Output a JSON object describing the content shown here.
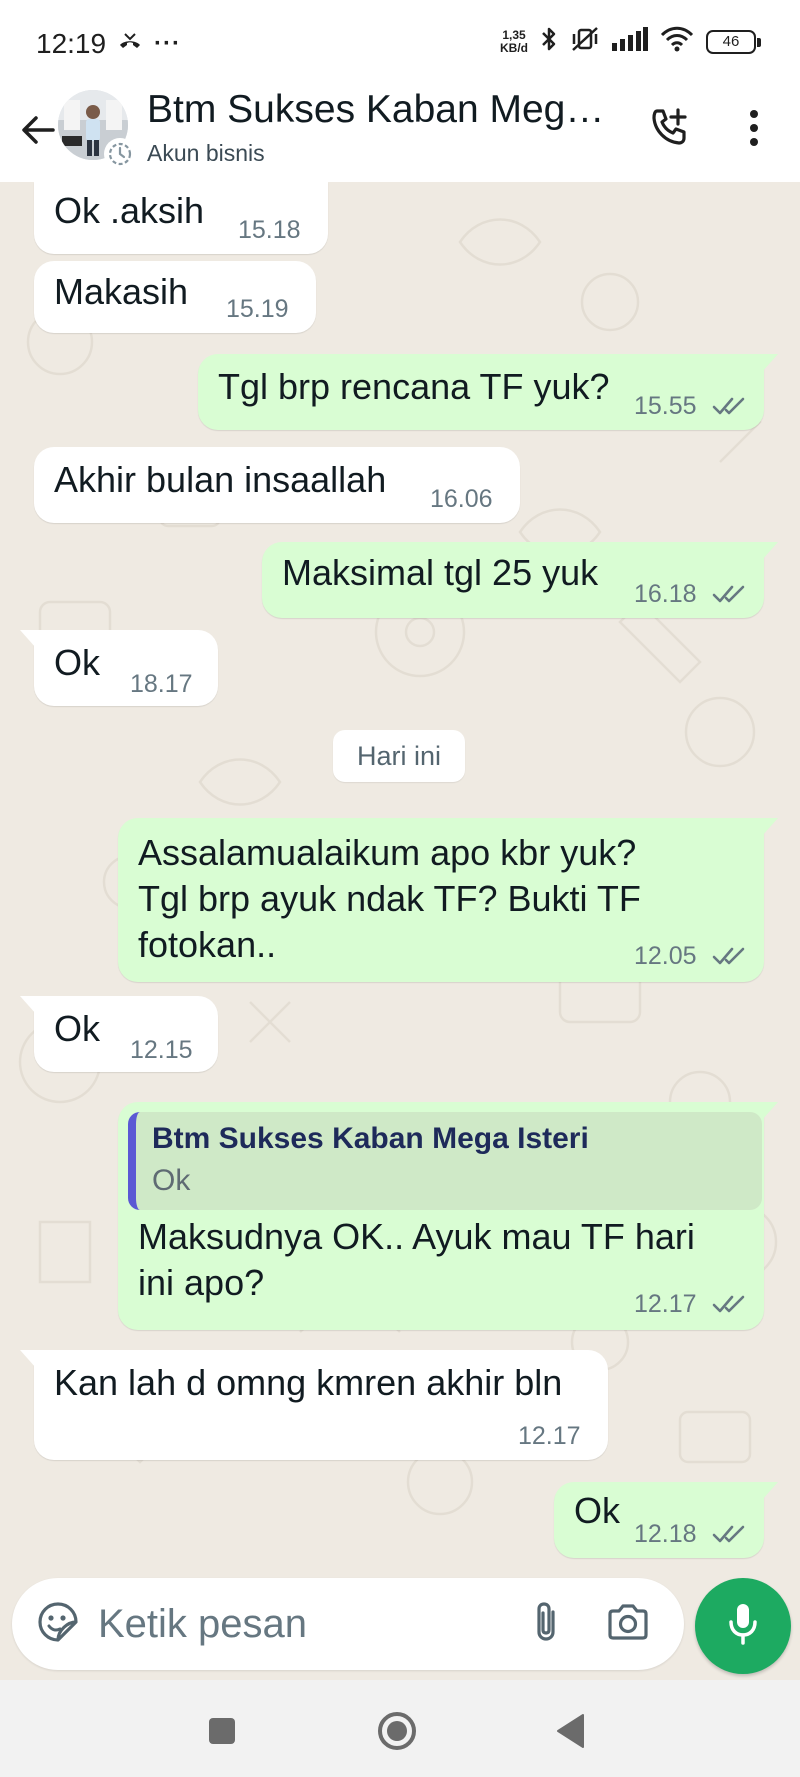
{
  "status_bar": {
    "time": "12:19",
    "more_dots": "···",
    "net_speed_value": "1,35",
    "net_speed_unit": "KB/d",
    "battery": "46"
  },
  "header": {
    "contact_name": "Btm Sukses Kaban Mega Isteri",
    "subtitle": "Akun bisnis"
  },
  "date_divider": "Hari ini",
  "messages": [
    {
      "dir": "in",
      "text": "Ok .aksih",
      "time": "15.18"
    },
    {
      "dir": "in",
      "text": "Makasih",
      "time": "15.19"
    },
    {
      "dir": "out",
      "text": "Tgl brp rencana TF yuk?",
      "time": "15.55",
      "status": "read"
    },
    {
      "dir": "in",
      "text": "Akhir bulan insaallah",
      "time": "16.06"
    },
    {
      "dir": "out",
      "text": "Maksimal tgl 25 yuk",
      "time": "16.18",
      "status": "read"
    },
    {
      "dir": "in",
      "text": "Ok",
      "time": "18.17"
    },
    {
      "dir": "out",
      "text": "Assalamualaikum apo kbr yuk?\nTgl brp ayuk ndak TF? Bukti TF\nfotokan..",
      "time": "12.05",
      "status": "read"
    },
    {
      "dir": "in",
      "text": "Ok",
      "time": "12.15"
    },
    {
      "dir": "out",
      "reply_to": {
        "name": "Btm Sukses Kaban Mega Isteri",
        "text": "Ok"
      },
      "text": "Maksudnya OK.. Ayuk mau TF hari\nini apo?",
      "time": "12.17",
      "status": "read"
    },
    {
      "dir": "in",
      "text": "Kan lah d omng kmren akhir bln",
      "time": "12.17"
    },
    {
      "dir": "out",
      "text": "Ok",
      "time": "12.18",
      "status": "read"
    }
  ],
  "composer": {
    "placeholder": "Ketik pesan"
  },
  "colors": {
    "outgoing_bubble": "#d9fdd3",
    "incoming_bubble": "#ffffff",
    "chat_background": "#efeae2",
    "accent_green": "#1daa61",
    "read_ticks": "#667781",
    "quote_bar": "#5b59d4"
  },
  "icons": {
    "back": "arrow-left-icon",
    "add_call": "phone-plus-icon",
    "menu": "more-vertical-icon",
    "emoji": "sticker-icon",
    "attach": "paperclip-icon",
    "camera": "camera-icon",
    "mic": "microphone-icon",
    "nav_recents": "square-icon",
    "nav_home": "circle-icon",
    "nav_back": "triangle-back-icon"
  }
}
